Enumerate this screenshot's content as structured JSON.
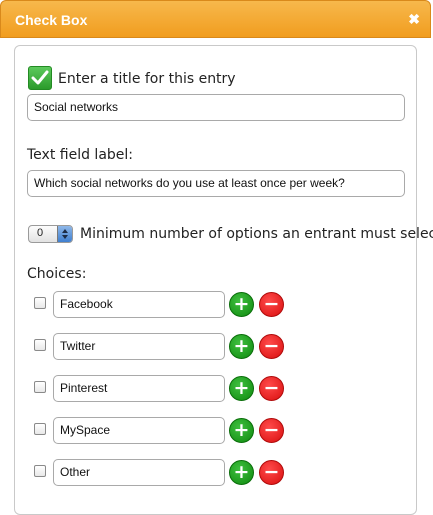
{
  "dialog": {
    "title": "Check Box",
    "close_glyph": "✖"
  },
  "entry": {
    "title_prompt": "Enter a title for this entry",
    "title_value": "Social networks",
    "field_label_prompt": "Text field label:",
    "field_label_value": "Which social networks do you use at least once per week?"
  },
  "minimum": {
    "value": "0",
    "label": "Minimum number of options an entrant must select"
  },
  "choices": {
    "heading": "Choices:",
    "items": [
      {
        "label": "Facebook",
        "checked": false
      },
      {
        "label": "Twitter",
        "checked": false
      },
      {
        "label": "Pinterest",
        "checked": false
      },
      {
        "label": "MySpace",
        "checked": false
      },
      {
        "label": "Other",
        "checked": false
      }
    ],
    "add_glyph": "+",
    "remove_glyph": "−"
  },
  "colors": {
    "title_bar": "#f19d1f",
    "add": "#0e8a0e",
    "remove": "#d90f0f",
    "check_icon": "#2b9b2b"
  },
  "icons": {
    "title_check": "checkmark-icon",
    "close": "close-icon",
    "add": "plus-icon",
    "remove": "minus-icon"
  }
}
